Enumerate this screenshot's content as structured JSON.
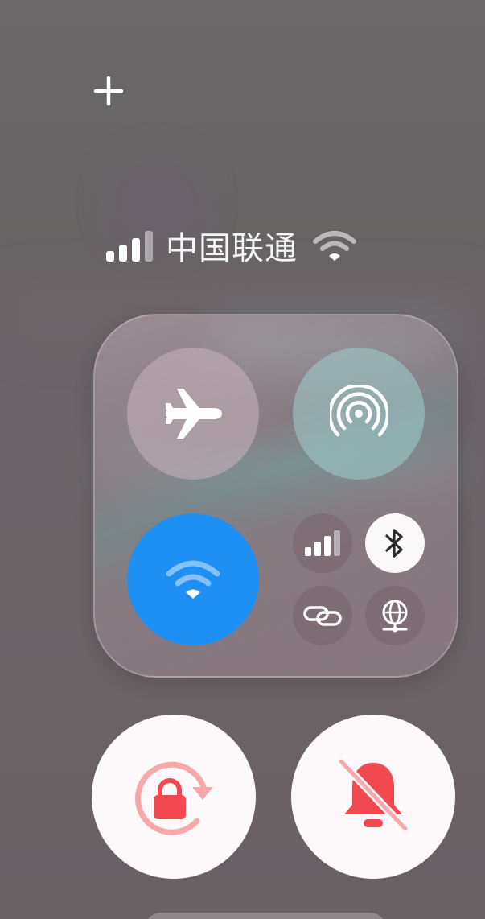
{
  "status": {
    "carrier": "中国联通",
    "signal_bars": 3,
    "signal_bars_total": 4,
    "wifi_connected": true
  },
  "toggles": {
    "airplane": {
      "icon": "airplane-icon",
      "on": false
    },
    "hotspot": {
      "icon": "hotspot-icon",
      "on": false
    },
    "wifi": {
      "icon": "wifi-icon",
      "on": true
    },
    "cellular": {
      "icon": "cellular-signal-icon",
      "on": false
    },
    "bluetooth": {
      "icon": "bluetooth-icon",
      "on": true
    },
    "link": {
      "icon": "link-icon",
      "on": false
    },
    "network": {
      "icon": "network-globe-icon",
      "on": false
    },
    "rotation_lock": {
      "icon": "rotation-lock-icon",
      "on": true
    },
    "silent": {
      "icon": "bell-slash-icon",
      "on": true
    }
  },
  "colors": {
    "accent_blue": "#1e8ff3",
    "alert_red": "#f2484f",
    "alert_pink": "#f7a8aa"
  }
}
